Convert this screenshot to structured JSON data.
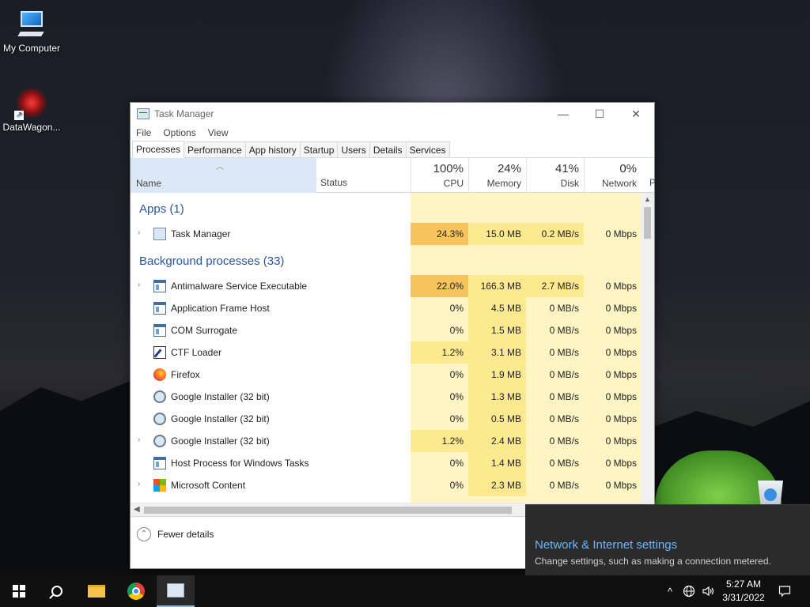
{
  "desktop": {
    "icons": [
      {
        "label": "My Computer"
      },
      {
        "label": "DataWagon..."
      }
    ]
  },
  "task_manager": {
    "title": "Task Manager",
    "window_buttons": {
      "minimize": "—",
      "maximize": "☐",
      "close": "✕"
    },
    "menu": [
      "File",
      "Options",
      "View"
    ],
    "tabs": [
      "Processes",
      "Performance",
      "App history",
      "Startup",
      "Users",
      "Details",
      "Services"
    ],
    "active_tab": "Processes",
    "columns": {
      "name": "Name",
      "status": "Status",
      "cpu": {
        "percent": "100%",
        "label": "CPU"
      },
      "memory": {
        "percent": "24%",
        "label": "Memory"
      },
      "disk": {
        "percent": "41%",
        "label": "Disk"
      },
      "network": {
        "percent": "0%",
        "label": "Network"
      },
      "more": "P"
    },
    "sections": {
      "apps": "Apps (1)",
      "background": "Background processes (33)"
    },
    "apps": [
      {
        "name": "Task Manager",
        "expandable": "›",
        "icon": "task-manager-icon",
        "cpu": "24.3%",
        "memory": "15.0 MB",
        "disk": "0.2 MB/s",
        "network": "0 Mbps"
      }
    ],
    "background": [
      {
        "name": "Antimalware Service Executable",
        "expandable": "›",
        "icon": "window-icon",
        "cpu": "22.0%",
        "memory": "166.3 MB",
        "disk": "2.7 MB/s",
        "network": "0 Mbps"
      },
      {
        "name": "Application Frame Host",
        "expandable": "",
        "icon": "window-icon",
        "cpu": "0%",
        "memory": "4.5 MB",
        "disk": "0 MB/s",
        "network": "0 Mbps"
      },
      {
        "name": "COM Surrogate",
        "expandable": "",
        "icon": "window-icon",
        "cpu": "0%",
        "memory": "1.5 MB",
        "disk": "0 MB/s",
        "network": "0 Mbps"
      },
      {
        "name": "CTF Loader",
        "expandable": "",
        "icon": "ctf-icon",
        "cpu": "1.2%",
        "memory": "3.1 MB",
        "disk": "0 MB/s",
        "network": "0 Mbps"
      },
      {
        "name": "Firefox",
        "expandable": "",
        "icon": "firefox-icon",
        "cpu": "0%",
        "memory": "1.9 MB",
        "disk": "0 MB/s",
        "network": "0 Mbps"
      },
      {
        "name": "Google Installer (32 bit)",
        "expandable": "",
        "icon": "google-installer-icon",
        "cpu": "0%",
        "memory": "1.3 MB",
        "disk": "0 MB/s",
        "network": "0 Mbps"
      },
      {
        "name": "Google Installer (32 bit)",
        "expandable": "",
        "icon": "google-installer-icon",
        "cpu": "0%",
        "memory": "0.5 MB",
        "disk": "0 MB/s",
        "network": "0 Mbps"
      },
      {
        "name": "Google Installer (32 bit)",
        "expandable": "›",
        "icon": "google-installer-icon",
        "cpu": "1.2%",
        "memory": "2.4 MB",
        "disk": "0 MB/s",
        "network": "0 Mbps"
      },
      {
        "name": "Host Process for Windows Tasks",
        "expandable": "",
        "icon": "window-icon",
        "cpu": "0%",
        "memory": "1.4 MB",
        "disk": "0 MB/s",
        "network": "0 Mbps"
      },
      {
        "name": "Microsoft Content",
        "expandable": "›",
        "icon": "microsoft-icon",
        "cpu": "0%",
        "memory": "2.3 MB",
        "disk": "0 MB/s",
        "network": "0 Mbps"
      }
    ],
    "footer": {
      "label": "Fewer details",
      "glyph": "⌃"
    }
  },
  "flyout": {
    "title": "Network & Internet settings",
    "description": "Change settings, such as making a connection metered."
  },
  "taskbar": {
    "tray_chevron": "^",
    "clock_time": "5:27 AM",
    "clock_date": "3/31/2022"
  },
  "colors": {
    "cpu_high": "#f7c35c",
    "cell_light": "#fff4c4",
    "cell_mid": "#fde98f",
    "section_blue": "#2a5599",
    "flyout_link": "#6cb7ff"
  }
}
